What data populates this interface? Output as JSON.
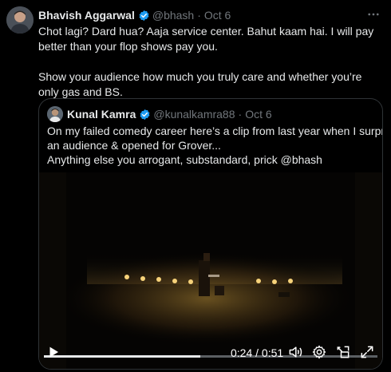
{
  "tweet": {
    "author_name": "Bhavish Aggarwal",
    "author_handle": "@bhash",
    "separator": "·",
    "date": "Oct 6",
    "text_p1": "Chot lagi? Dard hua? Aaja service center. Bahut kaam hai. I will pay better than your flop shows pay you.",
    "text_p2": "Show your audience how much you truly care and whether you’re only gas and BS."
  },
  "quote": {
    "author_name": "Kunal Kamra",
    "author_handle": "@kunalkamra88",
    "separator": "·",
    "date": "Oct 6",
    "line1": "On my failed comedy career here’s a clip from last year when I surprised",
    "line2": "an audience & opened for Grover...",
    "line3": "Anything else you arrogant, substandard, prick @bhash"
  },
  "video": {
    "time_display": "0:24 / 0:51",
    "progress_fraction": 0.47
  },
  "colors": {
    "background": "#000000",
    "text": "#e7e9ea",
    "muted": "#71767b",
    "verified": "#1d9bf0",
    "border": "#2f3336"
  },
  "icons": [
    "more-icon",
    "verified-badge-icon",
    "play-icon",
    "volume-icon",
    "settings-icon",
    "picture-in-picture-icon",
    "fullscreen-icon"
  ]
}
